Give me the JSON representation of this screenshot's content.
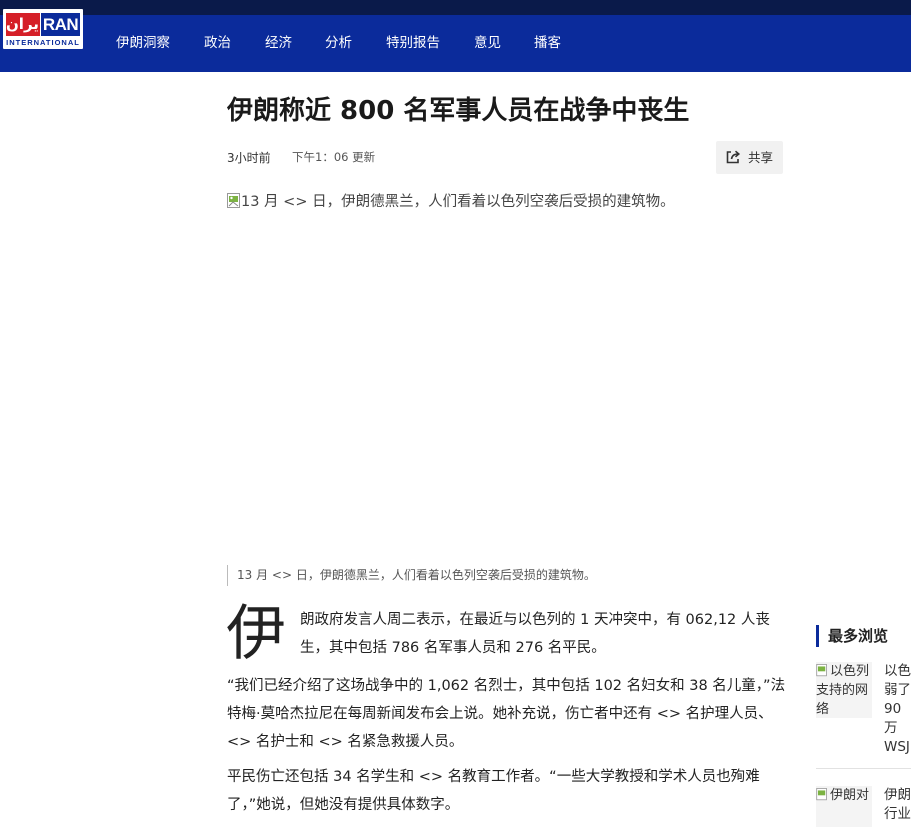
{
  "brand": {
    "logo_main_farsi": "ایران",
    "logo_main_latin": "RAN",
    "logo_sub": "INTERNATIONAL",
    "colors": {
      "nav_bg": "#0b2b9b",
      "top_bar": "#0a1a4a",
      "logo_red": "#d51f28"
    }
  },
  "nav": {
    "items": [
      {
        "label": "伊朗洞察"
      },
      {
        "label": "政治"
      },
      {
        "label": "经济"
      },
      {
        "label": "分析"
      },
      {
        "label": "特别报告"
      },
      {
        "label": "意见"
      },
      {
        "label": "播客"
      }
    ]
  },
  "article": {
    "title": "伊朗称近 800 名军事人员在战争中丧生",
    "time_ago": "3小时前",
    "updated": "下午1：06 更新",
    "share_label": "共享",
    "share_icon": "share-icon",
    "hero_alt": "13 月 <> 日，伊朗德黑兰，人们看着以色列空袭后受损的建筑物。",
    "caption": "13 月 <> 日，伊朗德黑兰，人们看着以色列空袭后受损的建筑物。",
    "dropcap": "伊",
    "paragraphs": [
      "朗政府发言人周二表示，在最近与以色列的 1 天冲突中，有 062,12 人丧生，其中包括 786 名军事人员和 276 名平民。",
      "“我们已经介绍了这场战争中的 1,062 名烈士，其中包括 102 名妇女和 38 名儿童，”法特梅·莫哈杰拉尼在每周新闻发布会上说。她补充说，伤亡者中还有 <> 名护理人员、<> 名护士和 <> 名紧急救援人员。",
      "平民伤亡还包括 34 名学生和 <> 名教育工作者。“一些大学教授和学术人员也殉难了，”她说，但她没有提供具体数字。"
    ]
  },
  "sidebar": {
    "title": "最多浏览",
    "items": [
      {
        "thumb_alt": "以色列支持的网络",
        "headline": "以色弱了90 万WSJ"
      },
      {
        "thumb_alt": "伊朗对",
        "headline": "伊朗行业"
      }
    ]
  }
}
